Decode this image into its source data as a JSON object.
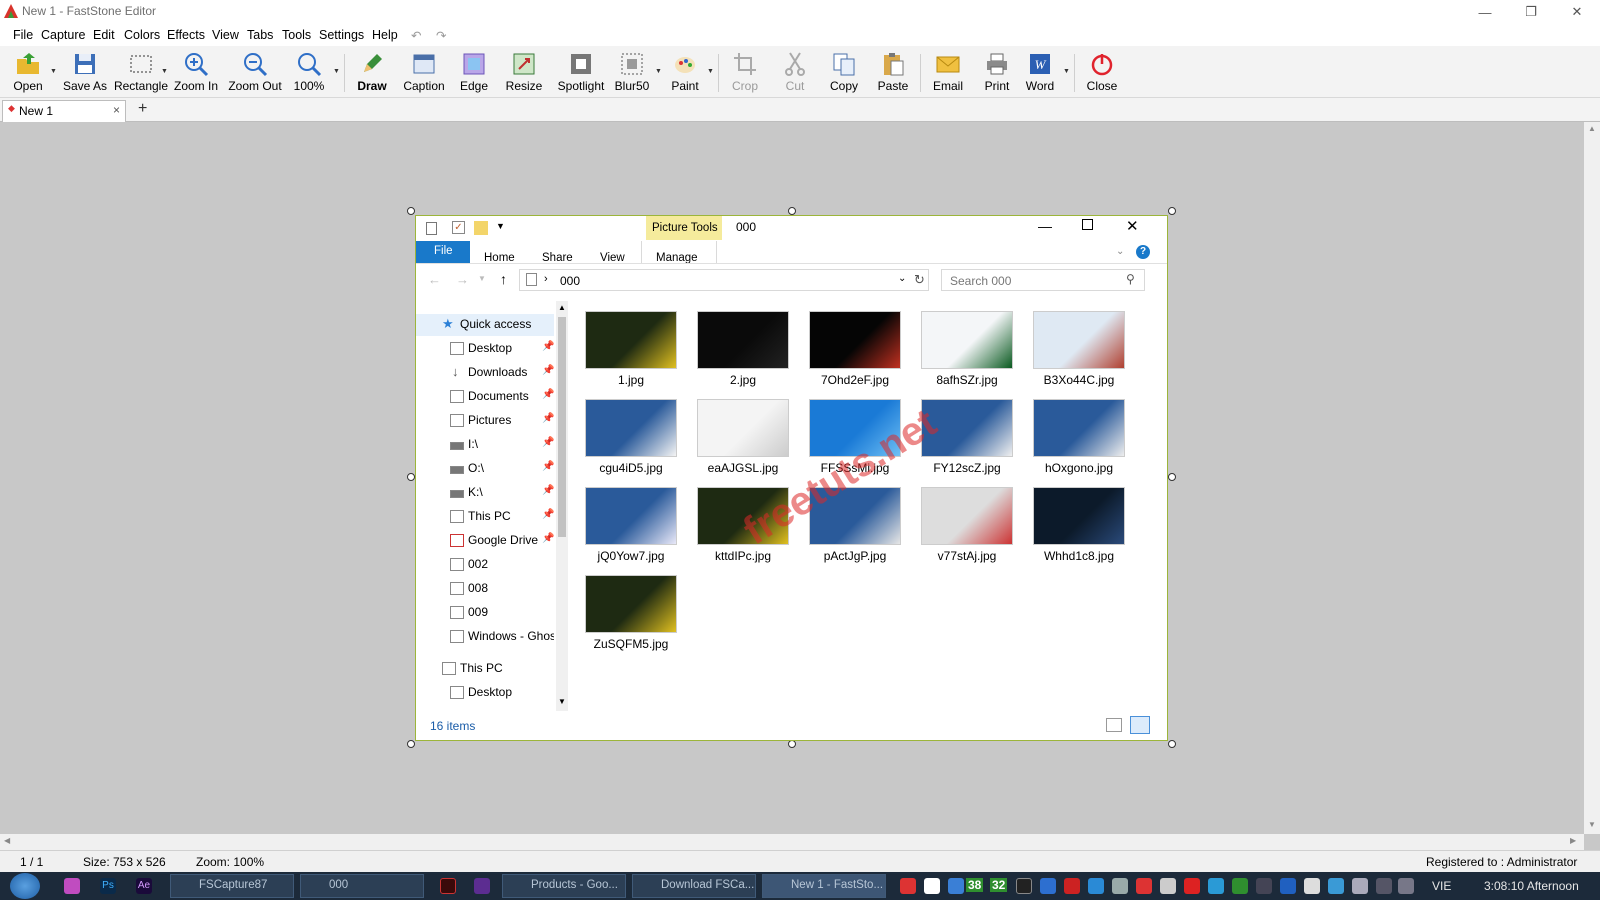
{
  "window": {
    "title": "New 1 - FastStone Editor",
    "min": "—",
    "restore": "❐",
    "close": "✕"
  },
  "menu": [
    "File",
    "Capture",
    "Edit",
    "Colors",
    "Effects",
    "View",
    "Tabs",
    "Tools",
    "Settings",
    "Help"
  ],
  "toolbar": {
    "open": "Open",
    "save_as": "Save As",
    "rectangle": "Rectangle",
    "zoom_in": "Zoom In",
    "zoom_out": "Zoom Out",
    "zoom_level": "100%",
    "draw": "Draw",
    "caption": "Caption",
    "edge": "Edge",
    "resize": "Resize",
    "spotlight": "Spotlight",
    "blur": "Blur50",
    "paint": "Paint",
    "crop": "Crop",
    "cut": "Cut",
    "copy": "Copy",
    "paste": "Paste",
    "email": "Email",
    "print": "Print",
    "word": "Word",
    "close": "Close"
  },
  "tabs": {
    "tab1": "New 1",
    "add": "+"
  },
  "explorer": {
    "context_tab": "Picture Tools",
    "folder_title": "000",
    "ribbon": {
      "file": "File",
      "home": "Home",
      "share": "Share",
      "view": "View",
      "manage": "Manage"
    },
    "address": "000",
    "search_placeholder": "Search 000",
    "nav": {
      "quick_access": "Quick access",
      "desktop": "Desktop",
      "downloads": "Downloads",
      "documents": "Documents",
      "pictures": "Pictures",
      "i": "I:\\",
      "o": "O:\\",
      "k": "K:\\",
      "this_pc_pinned": "This PC",
      "google_drive": "Google Drive",
      "f002": "002",
      "f008": "008",
      "f009": "009",
      "windows_ghost": "Windows - Ghos",
      "this_pc": "This PC",
      "desktop2": "Desktop"
    },
    "files": [
      "1.jpg",
      "2.jpg",
      "7Ohd2eF.jpg",
      "8afhSZr.jpg",
      "B3Xo44C.jpg",
      "cgu4iD5.jpg",
      "eaAJGSL.jpg",
      "FFSSsMi.jpg",
      "FY12scZ.jpg",
      "hOxgono.jpg",
      "jQ0Yow7.jpg",
      "kttdIPc.jpg",
      "pActJgP.jpg",
      "v77stAj.jpg",
      "Whhd1c8.jpg",
      "ZuSQFM5.jpg"
    ],
    "item_count": "16 items",
    "watermark": "freetuts.net"
  },
  "status": {
    "page": "1 / 1",
    "size": "Size: 753 x 526",
    "zoom": "Zoom: 100%",
    "registered": "Registered to : Administrator"
  },
  "taskbar": {
    "tasks": [
      "FSCapture87",
      "000",
      "Products - Goo...",
      "Download FSCa...",
      "New 1 - FastSto..."
    ],
    "tray_num1": "38",
    "tray_num2": "32",
    "lang": "VIE",
    "clock": "3:08:10 Afternoon"
  },
  "colors": {
    "accent": "#1979ca",
    "picture_tools": "#f5eb9c",
    "taskbar": "#1c2a3a",
    "explorer_border": "#9cb53a"
  }
}
